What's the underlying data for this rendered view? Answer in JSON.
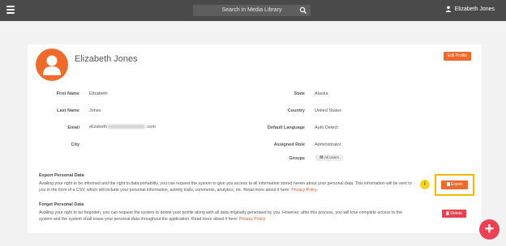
{
  "header": {
    "search_placeholder": "Search in Media Library",
    "user_name": "Elizabeth Jones"
  },
  "profile": {
    "name": "Elizabeth Jones",
    "edit_label": "Edit Profile",
    "fields_left": [
      {
        "label": "First Name",
        "value": "Elizabeth"
      },
      {
        "label": "Last Name",
        "value": "Jones"
      },
      {
        "label": "Email",
        "value_prefix": "elizabeth",
        "value_suffix": ".com"
      },
      {
        "label": "City",
        "value": ""
      }
    ],
    "fields_right": [
      {
        "label": "State",
        "value": "Alaska"
      },
      {
        "label": "Country",
        "value": "United States"
      },
      {
        "label": "Default Language",
        "value": "Auto Detect"
      },
      {
        "label": "Assigned Role",
        "value": "Administrator"
      },
      {
        "label": "Groups",
        "chip": "All Users"
      }
    ]
  },
  "export_section": {
    "title": "Export Personal Data",
    "text": "Availing your right to be informed and the right to data portability, you can request the system to give you access to all information stored herein about your personal data. This information will be sent to you in the form of a CSV, which will include your personal information, activity trails, comments, analytics, etc. Read more about it here:",
    "link": "Privacy Policy",
    "button": "Export",
    "info_glyph": "i"
  },
  "forget_section": {
    "title": "Forget Personal Data",
    "text": "Availing your right to be forgotten, you can request the system to delete your profile along with all data originally generated by you. However, after this process, you will lose complete access to the system and the system shall erase your personal data throughout the application. Read more about it here:",
    "link": "Privacy Policy",
    "button": "Delete"
  },
  "fab_label": "+",
  "colors": {
    "accent": "#f06a2c",
    "danger": "#e8424f",
    "highlight": "#f5b700"
  }
}
